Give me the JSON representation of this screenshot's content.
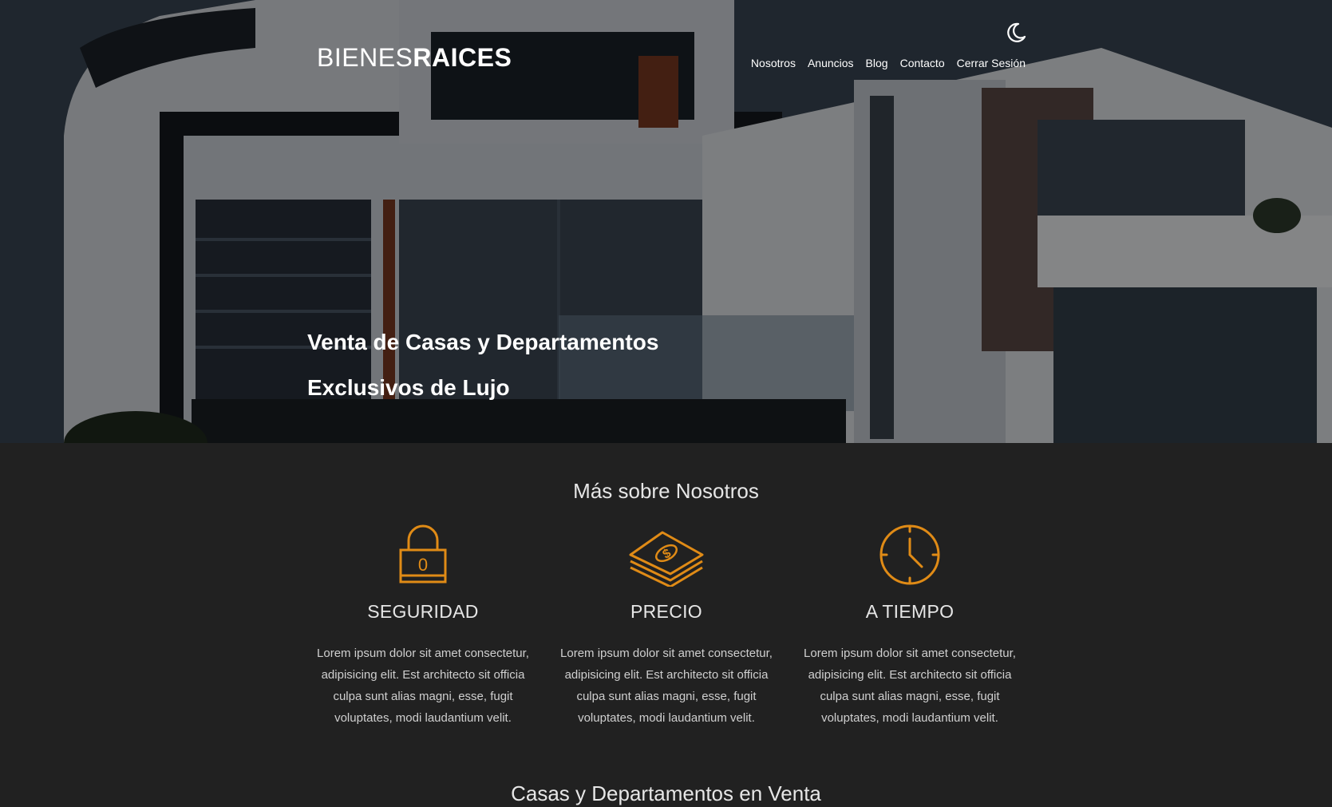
{
  "header": {
    "logo_light": "BIENES",
    "logo_bold": "RAICES",
    "nav": [
      {
        "label": "Nosotros"
      },
      {
        "label": "Anuncios"
      },
      {
        "label": "Blog"
      },
      {
        "label": "Contacto"
      },
      {
        "label": "Cerrar Sesión"
      }
    ],
    "theme_icon": "moon-icon"
  },
  "hero": {
    "title": "Venta de Casas y Departamentos Exclusivos de Lujo"
  },
  "about": {
    "title": "Más sobre Nosotros",
    "features": [
      {
        "icon": "lock-icon",
        "lock_digit": "0",
        "title": "SEGURIDAD",
        "text": "Lorem ipsum dolor sit amet consectetur, adipisicing elit. Est architecto sit officia culpa sunt alias magni, esse, fugit voluptates, modi laudantium velit."
      },
      {
        "icon": "money-icon",
        "title": "PRECIO",
        "text": "Lorem ipsum dolor sit amet consectetur, adipisicing elit. Est architecto sit officia culpa sunt alias magni, esse, fugit voluptates, modi laudantium velit."
      },
      {
        "icon": "clock-icon",
        "title": "A TIEMPO",
        "text": "Lorem ipsum dolor sit amet consectetur, adipisicing elit. Est architecto sit officia culpa sunt alias magni, esse, fugit voluptates, modi laudantium velit."
      }
    ]
  },
  "sale": {
    "title": "Casas y Departamentos en Venta"
  },
  "colors": {
    "accent": "#e08b16",
    "background": "#212121",
    "text": "#ffffff"
  }
}
